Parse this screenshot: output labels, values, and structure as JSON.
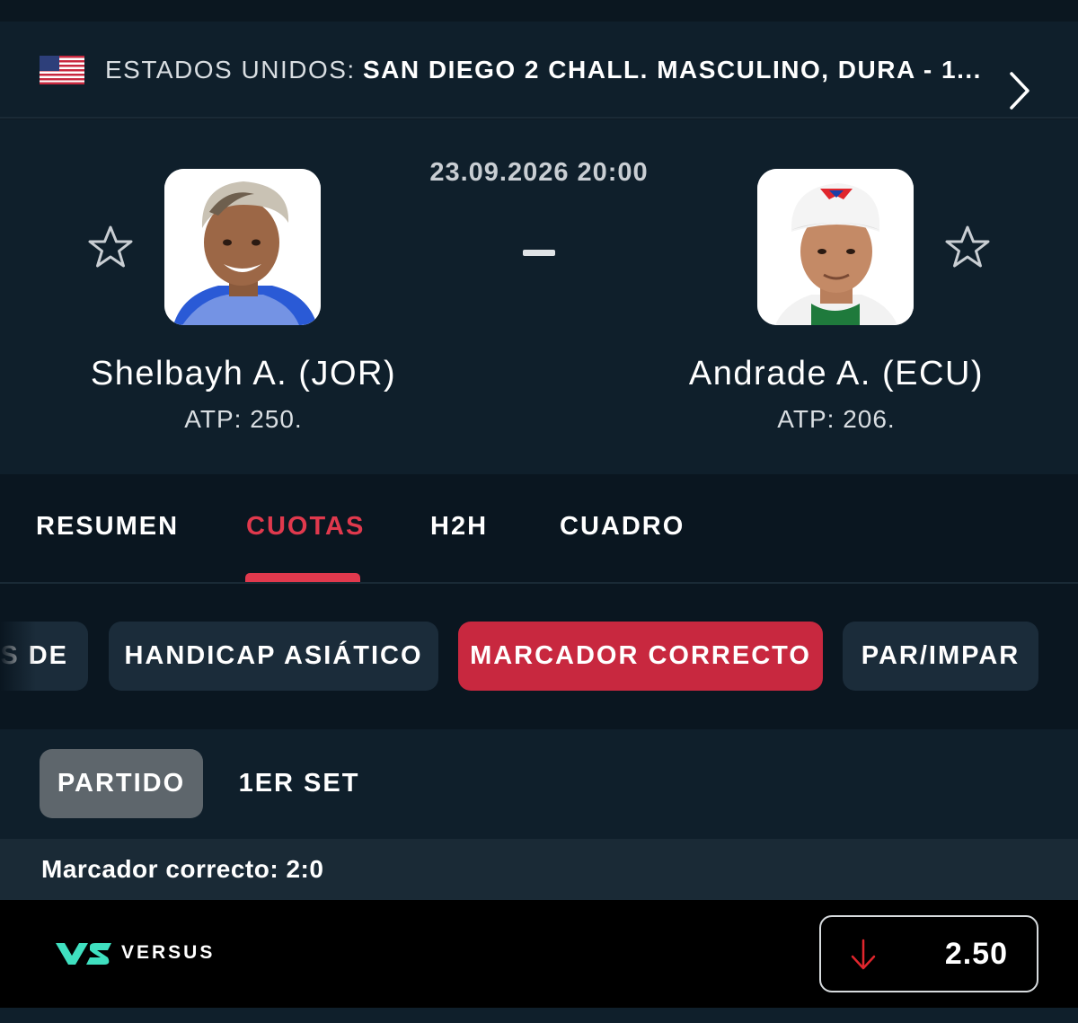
{
  "tournament": {
    "country": "ESTADOS UNIDOS:",
    "name": "SAN DIEGO 2 CHALL. MASCULINO, DURA - 1..."
  },
  "match": {
    "datetime": "23.09.2026 20:00",
    "score_separator": "-",
    "home": {
      "name": "Shelbayh A. (JOR)",
      "rank": "ATP: 250."
    },
    "away": {
      "name": "Andrade A. (ECU)",
      "rank": "ATP: 206."
    }
  },
  "tabs": [
    {
      "label": "RESUMEN",
      "active": false
    },
    {
      "label": "CUOTAS",
      "active": true
    },
    {
      "label": "H2H",
      "active": false
    },
    {
      "label": "CUADRO",
      "active": false
    }
  ],
  "markets": [
    {
      "label": "S DE",
      "active": false
    },
    {
      "label": "HANDICAP ASIÁTICO",
      "active": false
    },
    {
      "label": "MARCADOR CORRECTO",
      "active": true
    },
    {
      "label": "PAR/IMPAR",
      "active": false
    }
  ],
  "periods": [
    {
      "label": "PARTIDO",
      "active": true
    },
    {
      "label": "1ER SET",
      "active": false
    }
  ],
  "result": {
    "label": "Marcador correcto: 2:0"
  },
  "odds": {
    "bookmaker": "VERSUS",
    "value": "2.50",
    "trend": "down"
  },
  "colors": {
    "accent": "#e0394d",
    "active_pill": "#c8283f",
    "background": "#0f1f2b",
    "trend_down": "#e0262d",
    "versus_brand": "#3fe0c0"
  }
}
